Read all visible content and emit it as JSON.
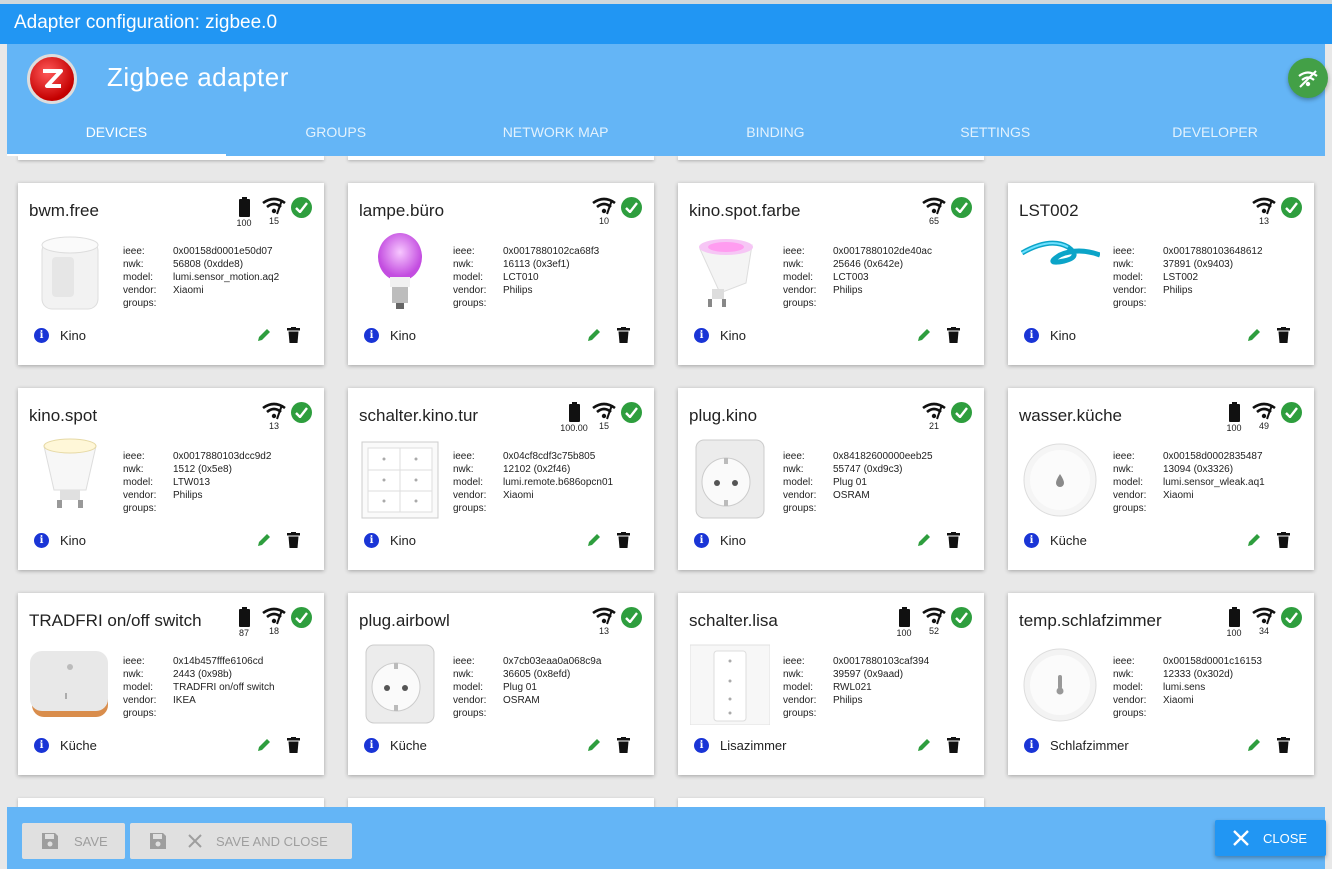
{
  "window": {
    "title": "Adapter configuration: zigbee.0"
  },
  "header": {
    "app_title": "Zigbee adapter"
  },
  "tabs": [
    "DEVICES",
    "GROUPS",
    "NETWORK MAP",
    "BINDING",
    "SETTINGS",
    "DEVELOPER"
  ],
  "prop_labels": {
    "ieee": "ieee:",
    "nwk": "nwk:",
    "model": "model:",
    "vendor": "vendor:",
    "groups": "groups:"
  },
  "devices": [
    {
      "name": "bwm.free",
      "battery": "100",
      "link": "15",
      "ieee": "0x00158d0001e50d07",
      "nwk": "56808 (0xdde8)",
      "model": "lumi.sensor_motion.aq2",
      "vendor": "Xiaomi",
      "room": "Kino",
      "thumb": "motion-sensor"
    },
    {
      "name": "lampe.büro",
      "battery": null,
      "link": "10",
      "ieee": "0x0017880102ca68f3",
      "nwk": "16113 (0x3ef1)",
      "model": "LCT010",
      "vendor": "Philips",
      "room": "Kino",
      "thumb": "color-bulb"
    },
    {
      "name": "kino.spot.farbe",
      "battery": null,
      "link": "65",
      "ieee": "0x0017880102de40ac",
      "nwk": "25646 (0x642e)",
      "model": "LCT003",
      "vendor": "Philips",
      "room": "Kino",
      "thumb": "spot-color"
    },
    {
      "name": "LST002",
      "battery": null,
      "link": "13",
      "ieee": "0x0017880103648612",
      "nwk": "37891 (0x9403)",
      "model": "LST002",
      "vendor": "Philips",
      "room": "Kino",
      "thumb": "lightstrip"
    },
    {
      "name": "kino.spot",
      "battery": null,
      "link": "13",
      "ieee": "0x0017880103dcc9d2",
      "nwk": "1512 (0x5e8)",
      "model": "LTW013",
      "vendor": "Philips",
      "room": "Kino",
      "thumb": "spot-white"
    },
    {
      "name": "schalter.kino.tur",
      "battery": "100.00",
      "link": "15",
      "ieee": "0x04cf8cdf3c75b805",
      "nwk": "12102 (0x2f46)",
      "model": "lumi.remote.b686opcn01",
      "vendor": "Xiaomi",
      "room": "Kino",
      "thumb": "wall-switch"
    },
    {
      "name": "plug.kino",
      "battery": null,
      "link": "21",
      "ieee": "0x84182600000eeb25",
      "nwk": "55747 (0xd9c3)",
      "model": "Plug 01",
      "vendor": "OSRAM",
      "room": "Kino",
      "thumb": "plug"
    },
    {
      "name": "wasser.küche",
      "battery": "100",
      "link": "49",
      "ieee": "0x00158d0002835487",
      "nwk": "13094 (0x3326)",
      "model": "lumi.sensor_wleak.aq1",
      "vendor": "Xiaomi",
      "room": "Küche",
      "thumb": "water-sensor"
    },
    {
      "name": "TRADFRI on/off switch",
      "battery": "87",
      "link": "18",
      "ieee": "0x14b457fffe6106cd",
      "nwk": "2443 (0x98b)",
      "model": "TRADFRI on/off switch",
      "vendor": "IKEA",
      "room": "Küche",
      "thumb": "ikea-switch"
    },
    {
      "name": "plug.airbowl",
      "battery": null,
      "link": "13",
      "ieee": "0x7cb03eaa0a068c9a",
      "nwk": "36605 (0x8efd)",
      "model": "Plug 01",
      "vendor": "OSRAM",
      "room": "Küche",
      "thumb": "plug"
    },
    {
      "name": "schalter.lisa",
      "battery": "100",
      "link": "52",
      "ieee": "0x0017880103caf394",
      "nwk": "39597 (0x9aad)",
      "model": "RWL021",
      "vendor": "Philips",
      "room": "Lisazimmer",
      "thumb": "dimmer"
    },
    {
      "name": "temp.schlafzimmer",
      "battery": "100",
      "link": "34",
      "ieee": "0x00158d0001c16153",
      "nwk": "12333 (0x302d)",
      "model": "lumi.sens",
      "vendor": "Xiaomi",
      "room": "Schlafzimmer",
      "thumb": "temp-sensor"
    }
  ],
  "bottom": {
    "save": "SAVE",
    "save_close": "SAVE AND CLOSE",
    "close": "CLOSE"
  }
}
